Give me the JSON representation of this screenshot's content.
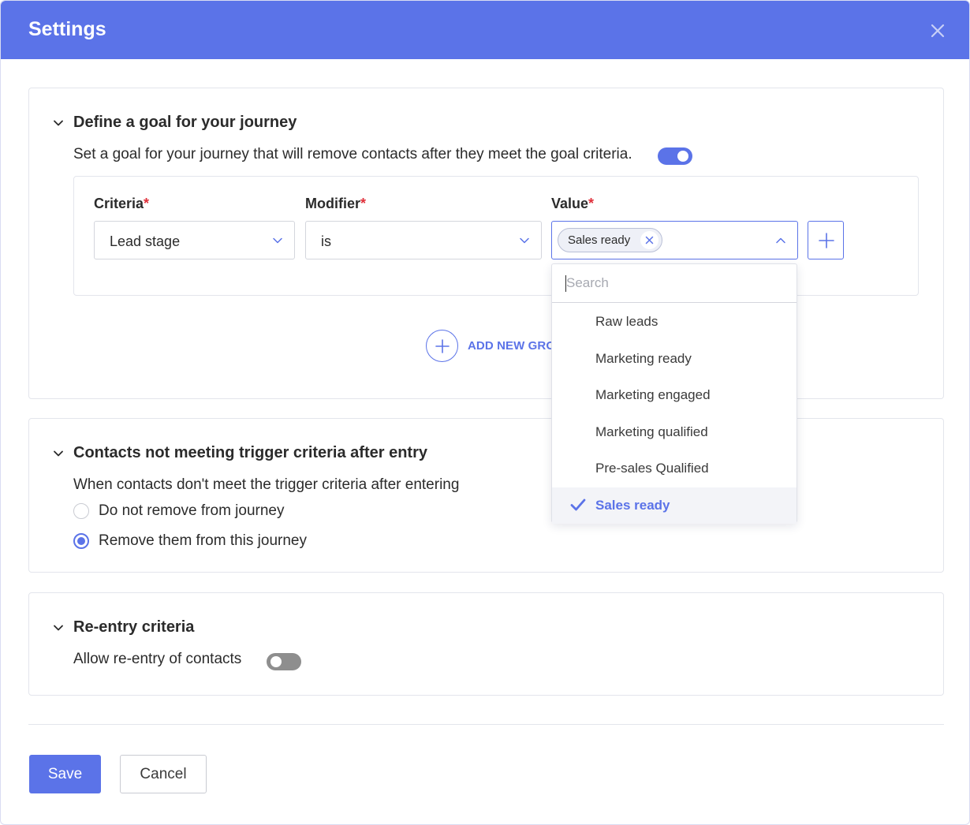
{
  "dialog": {
    "title": "Settings",
    "close_icon": "close-icon"
  },
  "goal_section": {
    "title": "Define a goal for your journey",
    "description": "Set a goal for your journey that will remove contacts after they meet the goal criteria.",
    "goal_enabled": true,
    "criteria": {
      "label": "Criteria",
      "value": "Lead stage"
    },
    "modifier": {
      "label": "Modifier",
      "value": "is"
    },
    "value_field": {
      "label": "Value",
      "chips": [
        "Sales ready"
      ]
    },
    "required_mark": "*",
    "add_group_label": "ADD NEW GRO"
  },
  "value_dropdown": {
    "search_placeholder": "Search",
    "options": [
      {
        "label": "Raw leads",
        "selected": false
      },
      {
        "label": "Marketing ready",
        "selected": false
      },
      {
        "label": "Marketing engaged",
        "selected": false
      },
      {
        "label": "Marketing qualified",
        "selected": false
      },
      {
        "label": "Pre-sales Qualified",
        "selected": false
      },
      {
        "label": "Sales ready",
        "selected": true
      }
    ]
  },
  "trigger_section": {
    "title": "Contacts not meeting trigger criteria after entry",
    "description": "When contacts don't meet the trigger criteria after entering",
    "options": [
      {
        "label": "Do not remove from journey",
        "checked": false
      },
      {
        "label": "Remove them from this journey",
        "checked": true
      }
    ]
  },
  "reentry_section": {
    "title": "Re-entry criteria",
    "description": "Allow re-entry of contacts",
    "reentry_enabled": false
  },
  "footer": {
    "save_label": "Save",
    "cancel_label": "Cancel"
  },
  "colors": {
    "accent": "#5b73e8",
    "required": "#e0303a",
    "toggle_off": "#8e8e8e"
  }
}
